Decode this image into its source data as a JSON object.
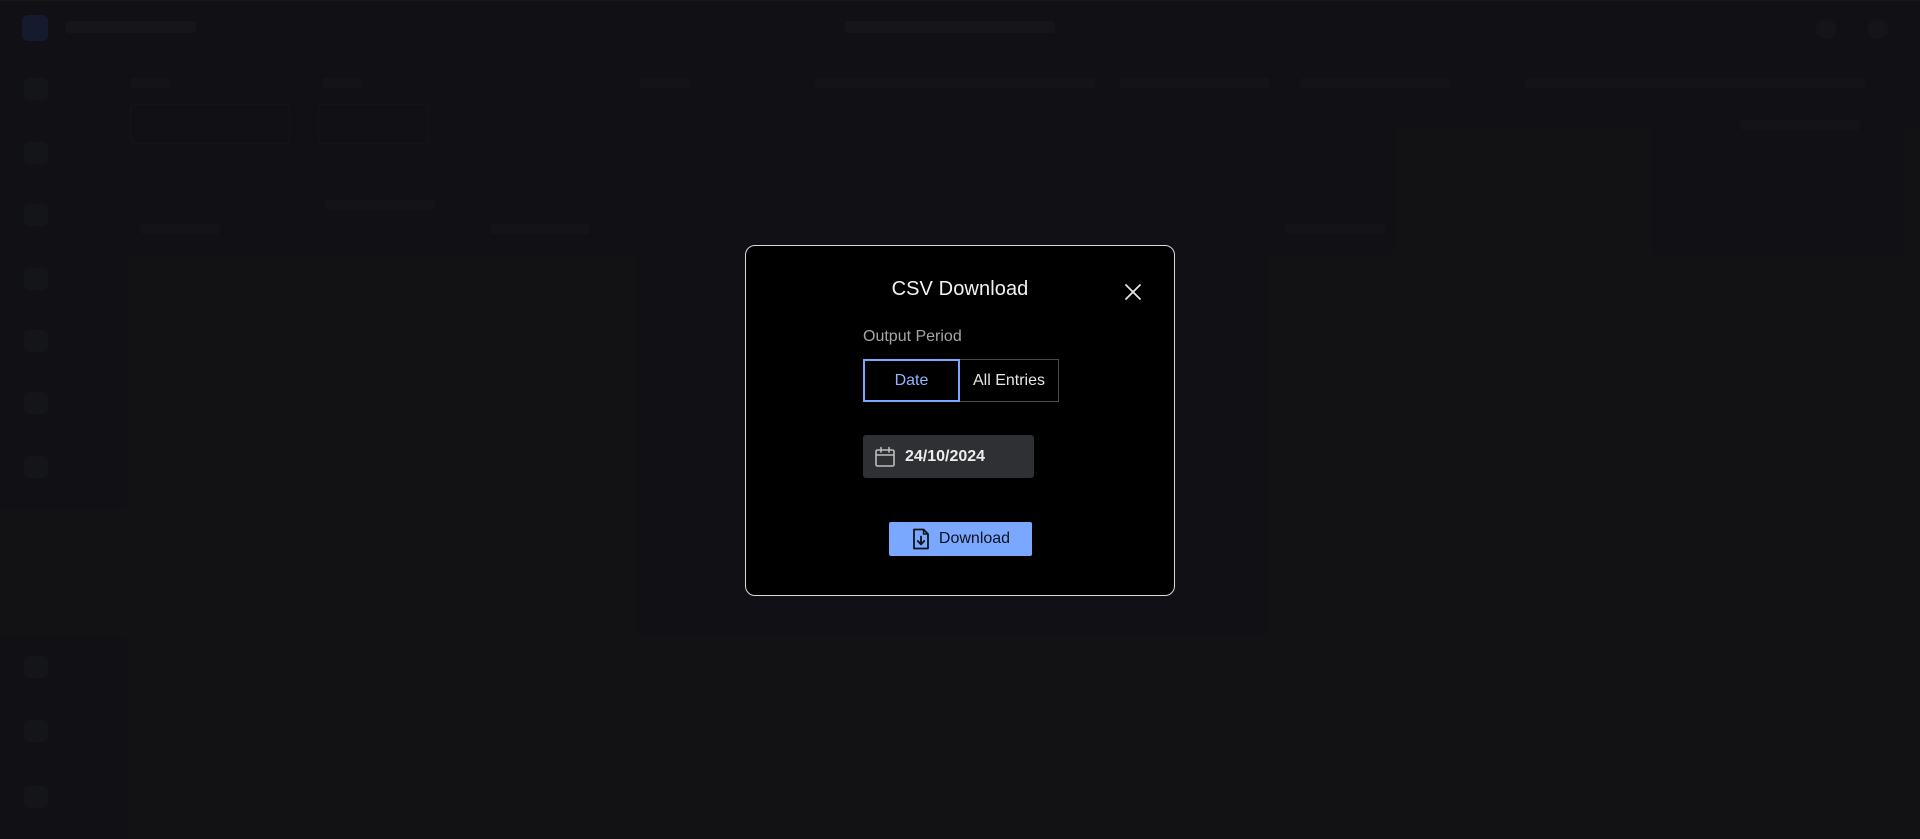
{
  "modal": {
    "title": "CSV Download",
    "output_period_label": "Output Period",
    "segments": [
      {
        "label": "Date",
        "selected": true
      },
      {
        "label": "All Entries",
        "selected": false
      }
    ],
    "date_value": "24/10/2024",
    "download_label": "Download",
    "icons": {
      "close": "close-icon",
      "calendar": "calendar-icon",
      "download": "file-download-icon"
    }
  },
  "colors": {
    "accent": "#7aa7ff",
    "modal_bg": "#000000",
    "page_bg": "#1b1c1f"
  }
}
